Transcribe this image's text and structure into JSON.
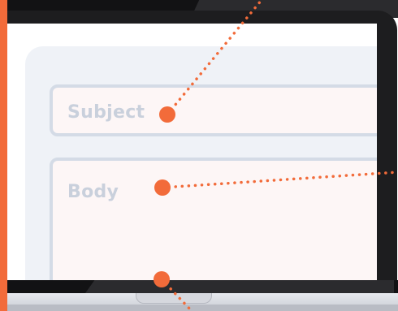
{
  "form": {
    "subject_label": "Subject",
    "body_label": "Body"
  },
  "callouts": [
    {
      "name": "subject-marker"
    },
    {
      "name": "body-marker"
    },
    {
      "name": "send-marker"
    }
  ],
  "colors": {
    "accent": "#f26b3a",
    "bezel": "#1d1d1f",
    "panel": "#eff2f7",
    "field_bg": "#fdf6f6",
    "field_border": "#d4dbe6",
    "label": "#c9d0dc"
  }
}
